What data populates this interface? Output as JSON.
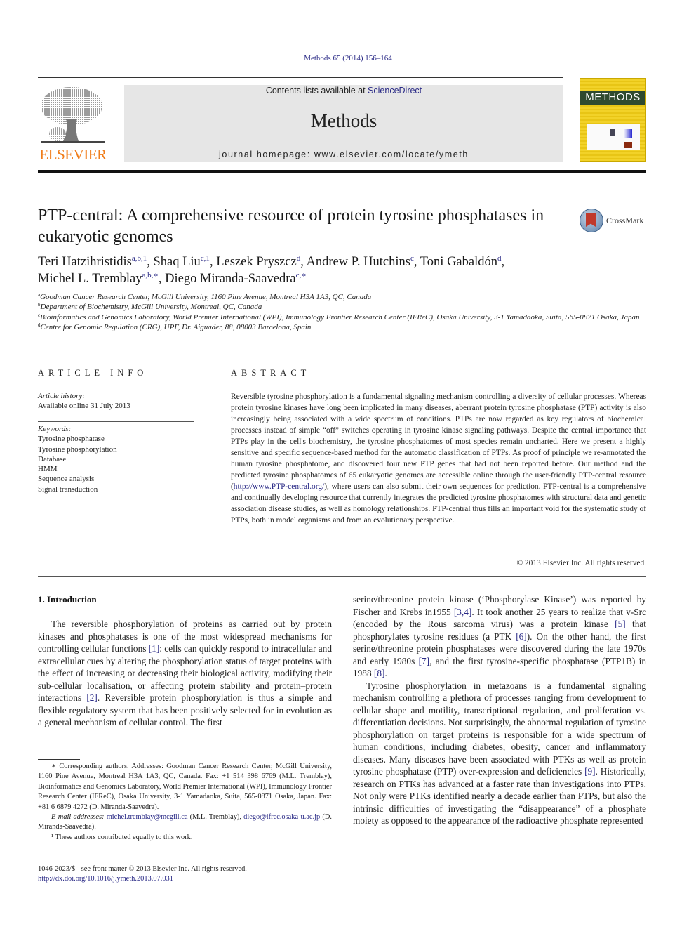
{
  "header": {
    "journal_ref": "Methods 65 (2014) 156–164",
    "contents_prefix": "Contents lists available at ",
    "contents_link": "ScienceDirect",
    "journal_title": "Methods",
    "homepage_prefix": "journal homepage: ",
    "homepage_url": "www.elsevier.com/locate/ymeth",
    "publisher_logo_text": "ELSEVIER",
    "cover_title": "METHODS",
    "brand_color": "#f07d1a",
    "link_color": "#2a2a86"
  },
  "article": {
    "title": "PTP-central: A comprehensive resource of protein tyrosine phosphatases in eukaryotic genomes",
    "crossmark_label": "CrossMark",
    "authors": [
      {
        "name": "Teri Hatzihristidis",
        "sup": "a,b,1",
        "sep": ", "
      },
      {
        "name": "Shaq Liu",
        "sup": "c,1",
        "sep": ", "
      },
      {
        "name": "Leszek Pryszcz",
        "sup": "d",
        "sep": ", "
      },
      {
        "name": "Andrew P. Hutchins",
        "sup": "c",
        "sep": ", "
      },
      {
        "name": "Toni Gabaldón",
        "sup": "d",
        "sep": ","
      },
      {
        "name": "Michel L. Tremblay",
        "sup": "a,b,∗",
        "sep": ", "
      },
      {
        "name": "Diego Miranda-Saavedra",
        "sup": "c,∗",
        "sep": ""
      }
    ],
    "affiliations": [
      {
        "key": "a",
        "text": "Goodman Cancer Research Center, McGill University, 1160 Pine Avenue, Montreal H3A 1A3, QC, Canada"
      },
      {
        "key": "b",
        "text": "Department of Biochemistry, McGill University, Montreal, QC, Canada"
      },
      {
        "key": "c",
        "text": "Bioinformatics and Genomics Laboratory, World Premier International (WPI), Immunology Frontier Research Center (IFReC), Osaka University, 3-1 Yamadaoka, Suita, 565-0871 Osaka, Japan"
      },
      {
        "key": "d",
        "text": "Centre for Genomic Regulation (CRG), UPF, Dr. Aiguader, 88, 08003 Barcelona, Spain"
      }
    ]
  },
  "article_info": {
    "heading": "ARTICLE INFO",
    "history_label": "Article history:",
    "history_value": "Available online 31 July 2013",
    "keywords_label": "Keywords:",
    "keywords": [
      "Tyrosine phosphatase",
      "Tyrosine phosphorylation",
      "Database",
      "HMM",
      "Sequence analysis",
      "Signal transduction"
    ]
  },
  "abstract": {
    "heading": "ABSTRACT",
    "text_before_link": "Reversible tyrosine phosphorylation is a fundamental signaling mechanism controlling a diversity of cellular processes. Whereas protein tyrosine kinases have long been implicated in many diseases, aberrant protein tyrosine phosphatase (PTP) activity is also increasingly being associated with a wide spectrum of conditions. PTPs are now regarded as key regulators of biochemical processes instead of simple “off” switches operating in tyrosine kinase signaling pathways. Despite the central importance that PTPs play in the cell's biochemistry, the tyrosine phosphatomes of most species remain uncharted. Here we present a highly sensitive and specific sequence-based method for the automatic classification of PTPs. As proof of principle we re-annotated the human tyrosine phosphatome, and discovered four new PTP genes that had not been reported before. Our method and the predicted tyrosine phosphatomes of 65 eukaryotic genomes are accessible online through the user-friendly PTP-central resource (",
    "link": "http://www.PTP-central.org/",
    "text_after_link": "), where users can also submit their own sequences for prediction. PTP-central is a comprehensive and continually developing resource that currently integrates the predicted tyrosine phosphatomes with structural data and genetic association disease studies, as well as homology relationships. PTP-central thus fills an important void for the systematic study of PTPs, both in model organisms and from an evolutionary perspective.",
    "copyright": "© 2013 Elsevier Inc. All rights reserved."
  },
  "introduction": {
    "heading": "1. Introduction",
    "left_col": {
      "p1_a": "The reversible phosphorylation of proteins as carried out by protein kinases and phosphatases is one of the most widespread mechanisms for controlling cellular functions ",
      "ref1": "[1]",
      "p1_b": ": cells can quickly respond to intracellular and extracellular cues by altering the phosphorylation status of target proteins with the effect of increasing or decreasing their biological activity, modifying their sub-cellular localisation, or affecting protein stability and protein–protein interactions ",
      "ref2": "[2]",
      "p1_c": ". Reversible protein phosphorylation is thus a simple and flexible regulatory system that has been positively selected for in evolution as a general mechanism of cellular control. The first"
    },
    "right_col": {
      "p1_a": "serine/threonine protein kinase (‘Phosphorylase Kinase’) was reported by Fischer and Krebs in1955 ",
      "ref34": "[3,4]",
      "p1_b": ". It took another 25 years to realize that v-Src (encoded by the Rous sarcoma virus) was a protein kinase ",
      "ref5": "[5]",
      "p1_c": " that phosphorylates tyrosine residues (a PTK ",
      "ref6": "[6]",
      "p1_d": "). On the other hand, the first serine/threonine protein phosphatases were discovered during the late 1970s and early 1980s ",
      "ref7": "[7]",
      "p1_e": ", and the first tyrosine-specific phosphatase (PTP1B) in 1988 ",
      "ref8": "[8]",
      "p1_f": ".",
      "p2_a": "Tyrosine phosphorylation in metazoans is a fundamental signaling mechanism controlling a plethora of processes ranging from development to cellular shape and motility, transcriptional regulation, and proliferation vs. differentiation decisions. Not surprisingly, the abnormal regulation of tyrosine phosphorylation on target proteins is responsible for a wide spectrum of human conditions, including diabetes, obesity, cancer and inflammatory diseases. Many diseases have been associated with PTKs as well as protein tyrosine phosphatase (PTP) over-expression and deficiencies ",
      "ref9": "[9]",
      "p2_b": ". Historically, research on PTKs has advanced at a faster rate than investigations into PTPs. Not only were PTKs identified nearly a decade earlier than PTPs, but also the intrinsic difficulties of investigating the “disappearance” of a phosphate moiety as opposed to the appearance of the radioactive phosphate represented"
    }
  },
  "footnotes": {
    "corresponding": "∗ Corresponding authors. Addresses: Goodman Cancer Research Center, McGill University, 1160 Pine Avenue, Montreal H3A 1A3, QC, Canada. Fax: +1 514 398 6769 (M.L. Tremblay), Bioinformatics and Genomics Laboratory, World Premier International (WPI), Immunology Frontier Research Center (IFReC), Osaka University, 3-1 Yamadaoka, Suita, 565-0871 Osaka, Japan. Fax: +81 6 6879 4272 (D. Miranda-Saavedra).",
    "email_label": "E-mail addresses: ",
    "email_1": "michel.tremblay@mcgill.ca",
    "email_1_owner": " (M.L. Tremblay), ",
    "email_2": "diego@ifrec.osaka-u.ac.jp",
    "email_2_owner": " (D. Miranda-Saavedra).",
    "equal_contrib": "¹ These authors contributed equally to this work."
  },
  "bottom": {
    "issn_line": "1046-2023/$ - see front matter © 2013 Elsevier Inc. All rights reserved.",
    "doi": "http://dx.doi.org/10.1016/j.ymeth.2013.07.031"
  }
}
